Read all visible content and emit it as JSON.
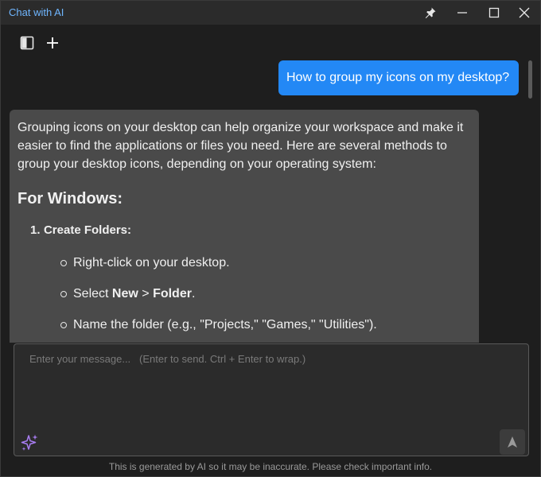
{
  "window": {
    "title": "Chat with AI"
  },
  "toolbar": {
    "sidebar_icon": "sidebar-toggle-icon",
    "new_chat_icon": "plus-icon"
  },
  "messages": {
    "user": "How to group my icons on my desktop?",
    "ai": {
      "intro": "Grouping icons on your desktop can help organize your workspace and make it easier to find the applications or files you need. Here are several methods to group your desktop icons, depending on your operating system:",
      "heading": "For Windows:",
      "step_number": "1.",
      "step_title": "Create Folders:",
      "bullets": {
        "b1": "Right-click on your desktop.",
        "b2_prefix": "Select ",
        "b2_new": "New",
        "b2_sep": " > ",
        "b2_folder": "Folder",
        "b2_suffix": ".",
        "b3": "Name the folder (e.g., \"Projects,\" \"Games,\" \"Utilities\")."
      }
    }
  },
  "composer": {
    "placeholder": "Enter your message...   (Enter to send. Ctrl + Enter to wrap.)"
  },
  "footer": {
    "disclaimer": "This is generated by AI so it may be inaccurate. Please check important info."
  },
  "colors": {
    "accent": "#2388f5",
    "title": "#6fb6ff",
    "sparkle": "#a77cf0"
  }
}
